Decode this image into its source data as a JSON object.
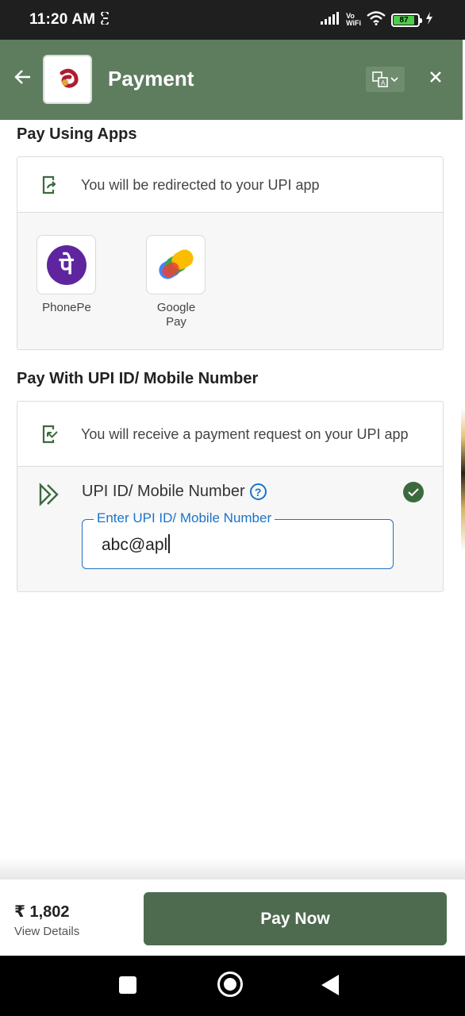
{
  "status_bar": {
    "time": "11:20 AM",
    "sim_icon": "sim-data-icon",
    "network_label_top": "Vo",
    "network_label_bottom": "WiFi",
    "battery_level": "87"
  },
  "header": {
    "title": "Payment",
    "back_icon": "arrow-left-icon",
    "translate_icon": "translate-icon",
    "close_icon": "close-icon",
    "bg_color": "#5e7d5f"
  },
  "pay_using_apps": {
    "title": "Pay Using Apps",
    "info_text": "You will be redirected to your UPI app",
    "apps": [
      {
        "name": "PhonePe",
        "glyph": "पे",
        "color": "#5f259f"
      },
      {
        "name": "Google Pay",
        "color": "#4285f4"
      }
    ]
  },
  "pay_with_upi": {
    "title": "Pay With UPI ID/ Mobile Number",
    "info_text": "You will receive a payment request on your UPI app",
    "field_label": "UPI ID/ Mobile Number",
    "help_glyph": "?",
    "input_legend": "Enter UPI ID/ Mobile Number",
    "input_value": "abc@apl",
    "verified": true
  },
  "footer": {
    "amount": "₹ 1,802",
    "view_details": "View Details",
    "pay_button": "Pay Now",
    "button_color": "#4e6b4f"
  }
}
